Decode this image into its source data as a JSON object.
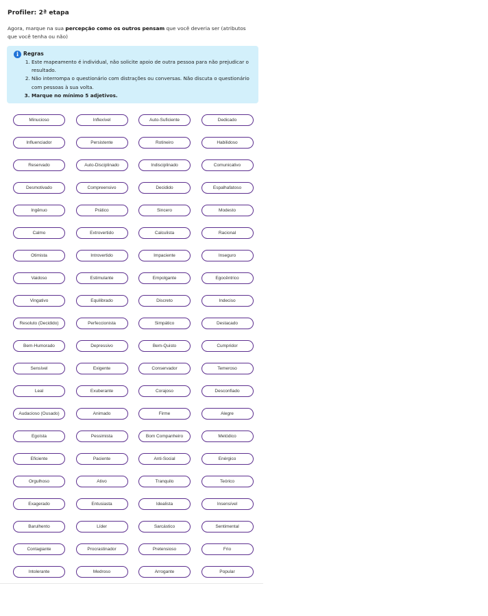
{
  "title": "Profiler: 2ª etapa",
  "intro": {
    "before": "Agora, marque na sua ",
    "bold": "percepção como os outros pensam",
    "after": " que você deveria ser (atributos que você tenha ou não)"
  },
  "rules": {
    "icon": "info-icon",
    "icon_glyph": "i",
    "title": "Regras",
    "items": [
      "Este mapeamento é individual, não solicite apoio de outra pessoa para não prejudicar o resultado.",
      "Não interrompa o questionário com distrações ou conversas. Não discuta o questionário com pessoas à sua volta.",
      "Marque no mínimo 5 adjetivos."
    ]
  },
  "adjectives": [
    "Minucioso",
    "Inflexível",
    "Auto-Suficiente",
    "Dedicado",
    "Influenciador",
    "Persistente",
    "Rotineiro",
    "Habilidoso",
    "Reservado",
    "Auto-Disciplinado",
    "Indisciplinado",
    "Comunicativo",
    "Desmotivado",
    "Compreensivo",
    "Decidido",
    "Espalhafatoso",
    "Ingênuo",
    "Prático",
    "Sincero",
    "Modesto",
    "Calmo",
    "Extrovertido",
    "Calculista",
    "Racional",
    "Otimista",
    "Introvertido",
    "Impaciente",
    "Inseguro",
    "Vaidoso",
    "Estimulante",
    "Empolgante",
    "Egocêntrico",
    "Vingativo",
    "Equilibrado",
    "Discreto",
    "Indeciso",
    "Resoluto (Decidido)",
    "Perfeccionista",
    "Simpático",
    "Destacado",
    "Bem-Humorado",
    "Depressivo",
    "Bem-Quisto",
    "Cumpridor",
    "Sensível",
    "Exigente",
    "Conservador",
    "Temeroso",
    "Leal",
    "Exuberante",
    "Corajoso",
    "Desconfiado",
    "Audacioso (Ousado)",
    "Animado",
    "Firme",
    "Alegre",
    "Egoísta",
    "Pessimista",
    "Bom Companheiro",
    "Metódico",
    "Eficiente",
    "Paciente",
    "Anti-Social",
    "Enérgico",
    "Orgulhoso",
    "Ativo",
    "Tranquilo",
    "Teórico",
    "Exagerado",
    "Entusiasta",
    "Idealista",
    "Insensível",
    "Barulhento",
    "Líder",
    "Sarcástico",
    "Sentimental",
    "Contagiante",
    "Procrastinador",
    "Pretensioso",
    "Frio",
    "Intolerante",
    "Medroso",
    "Arrogante",
    "Popular"
  ],
  "colors": {
    "chip_border": "#5b2d8e",
    "rules_background": "#d3f0fb",
    "info_icon": "#1f74d8"
  }
}
